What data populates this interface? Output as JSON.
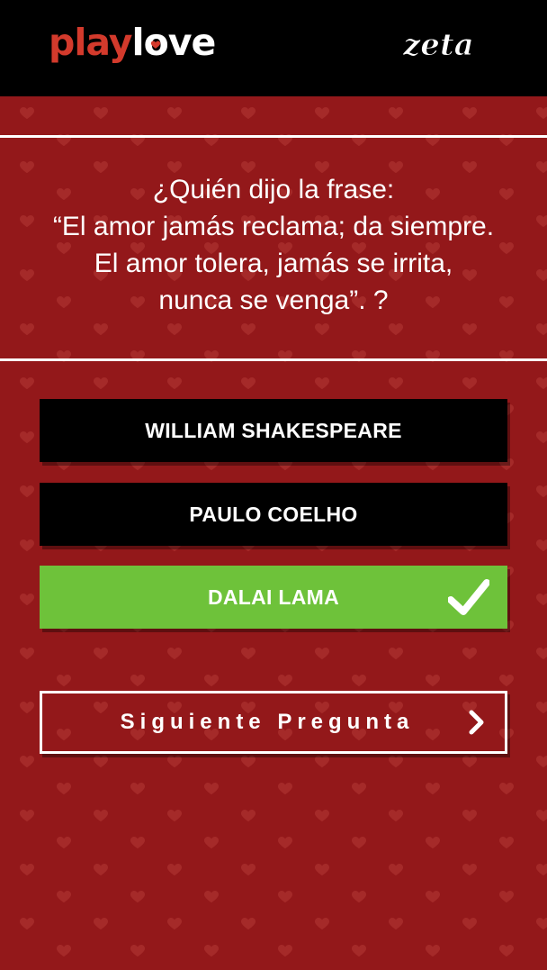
{
  "header": {
    "logo_play": "play",
    "logo_love_l": "l",
    "logo_love_o": "o",
    "logo_love_ve": "ve",
    "partner_logo": "zeta"
  },
  "quiz": {
    "question": "¿Quién dijo la frase:\n“El amor jamás reclama; da siempre.\nEl amor tolera, jamás se irrita,\nnunca se venga”. ?",
    "answers": [
      {
        "label": "WILLIAM SHAKESPEARE",
        "state": "default"
      },
      {
        "label": "PAULO COELHO",
        "state": "default"
      },
      {
        "label": "DALAI LAMA",
        "state": "correct"
      }
    ],
    "next_label": "Siguiente Pregunta"
  },
  "colors": {
    "background": "#93181a",
    "heart_pattern": "#a52a29",
    "header": "#000000",
    "logo_red": "#d33a2c",
    "correct": "#6ec23a",
    "answer_default": "#000000",
    "text": "#ffffff"
  },
  "icons": {
    "correct_marker": "check-icon",
    "next_marker": "chevron-right-icon",
    "background_pattern": "heart-icon"
  }
}
